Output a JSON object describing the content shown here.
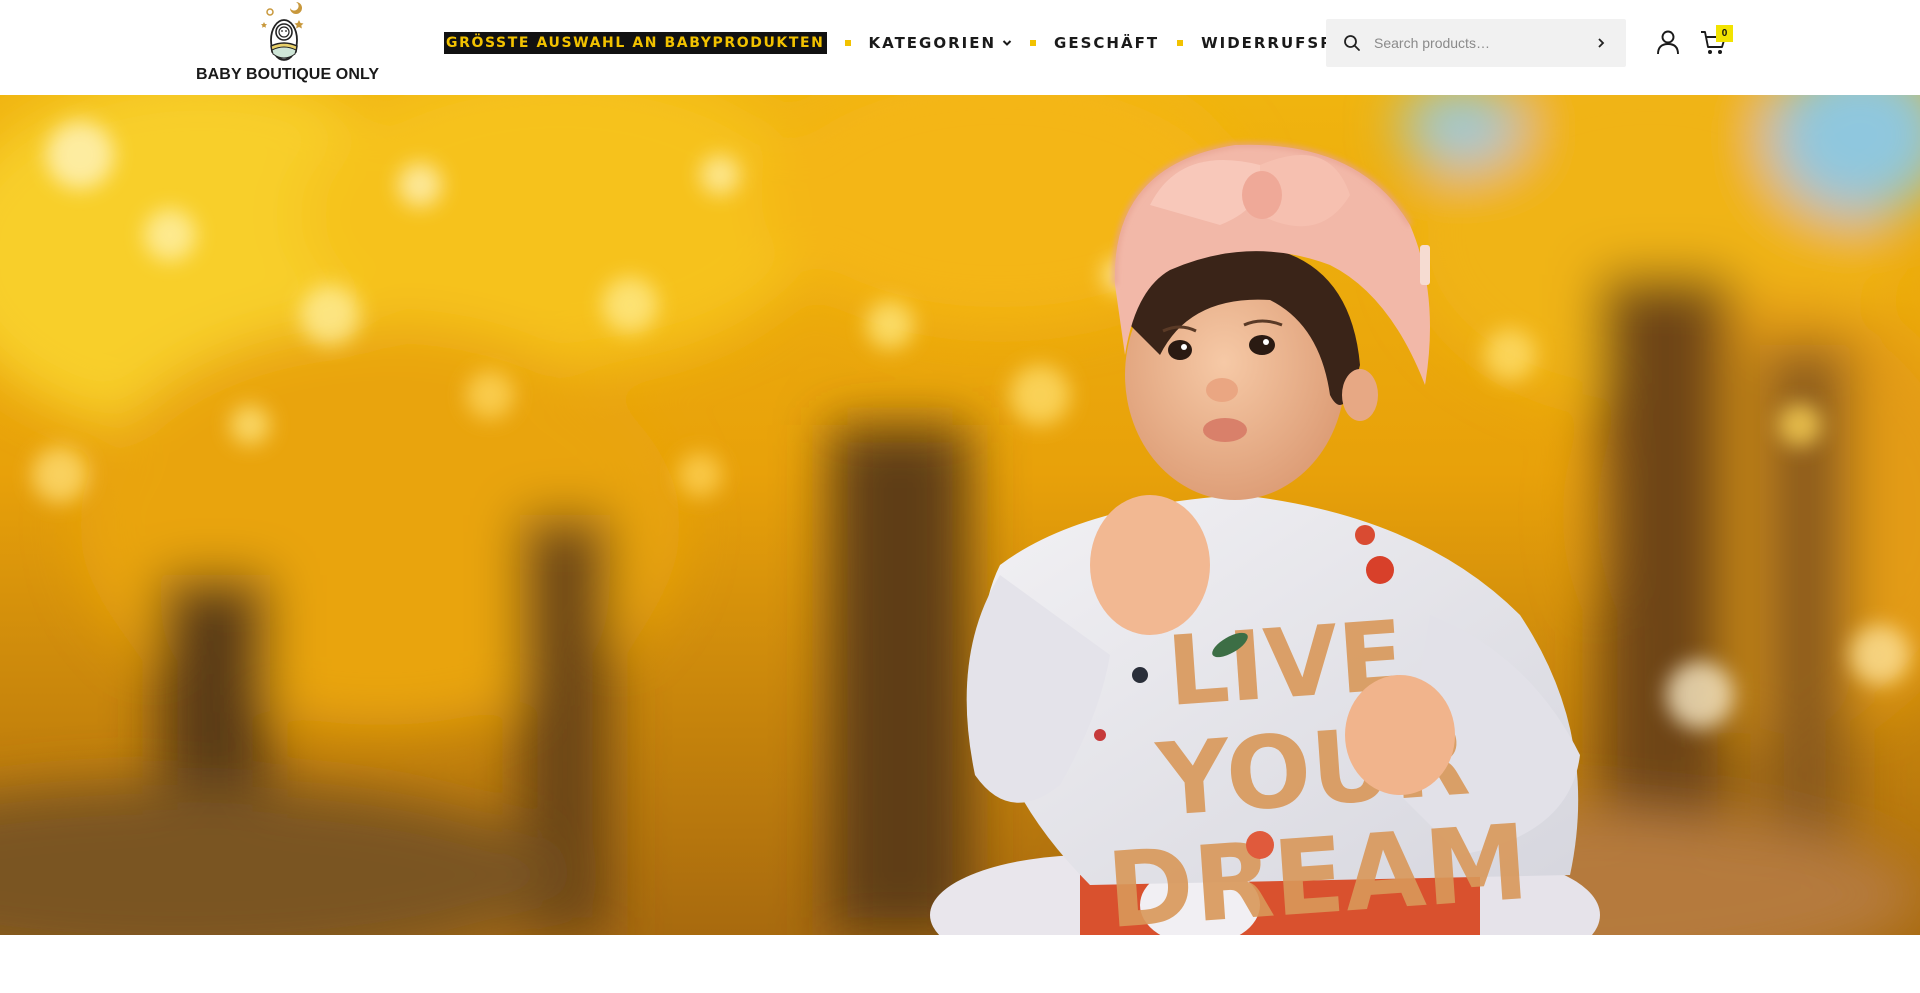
{
  "brand": {
    "name": "BABY BOUTIQUE ONLY",
    "logo_icon": "swaddled-baby-logo",
    "accent_color": "#f2c200"
  },
  "nav": {
    "items": [
      {
        "label": "GRÖSSTE AUSWAHL AN BABYPRODUKTEN",
        "highlight": true
      },
      {
        "label": "KATEGORIEN",
        "has_dropdown": true
      },
      {
        "label": "GESCHÄFT"
      },
      {
        "label": "WIDERRUFSRECHT"
      }
    ]
  },
  "search": {
    "placeholder": "Search products…",
    "value": "",
    "icon": "search-icon",
    "submit_icon": "chevron-right-icon"
  },
  "header_icons": {
    "account_icon": "user-icon",
    "cart_icon": "shopping-cart-icon",
    "cart_count": "0"
  },
  "hero": {
    "image": "baby-in-pink-hat-eating-fruit-autumn-trees",
    "shirt_print": "LIVE YOUR DREAM"
  }
}
